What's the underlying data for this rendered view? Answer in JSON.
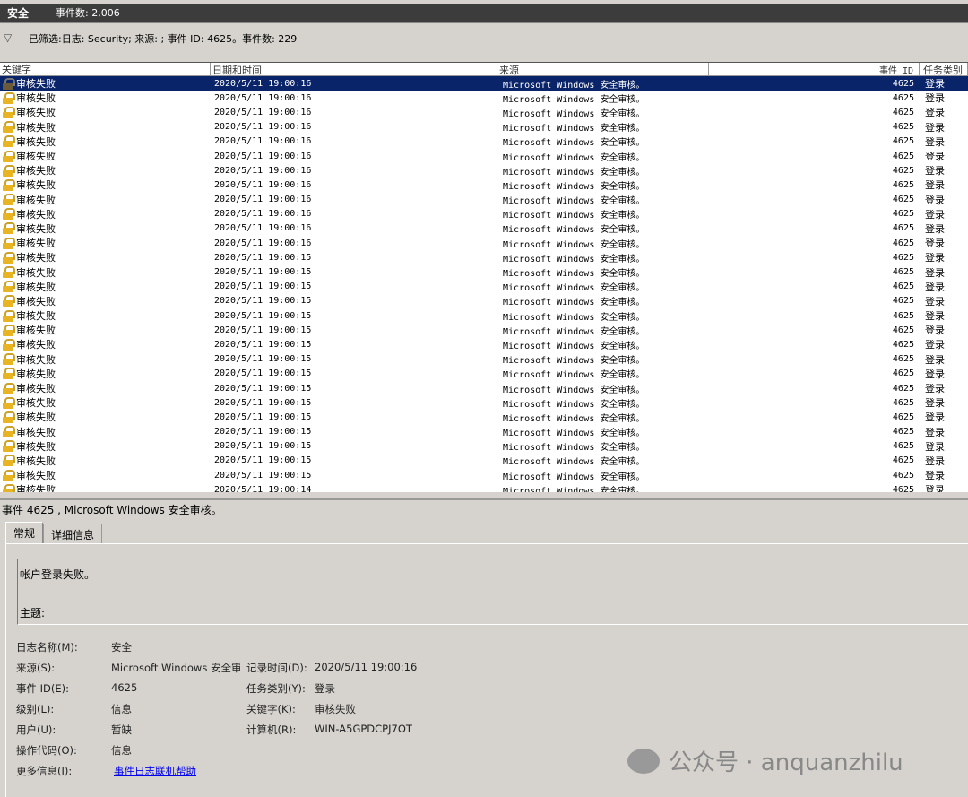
{
  "header": {
    "title": "安全",
    "event_count": "事件数: 2,006"
  },
  "filter": {
    "icon": "filter-icon",
    "text": "已筛选:日志: Security; 来源: ; 事件 ID: 4625。事件数: 229"
  },
  "columns": [
    "关键字",
    "日期和时间",
    "来源",
    "事件 ID",
    "任务类别"
  ],
  "rows": [
    [
      "审核失败",
      "2020/5/11 19:00:16",
      "Microsoft Windows 安全审核。",
      "4625",
      "登录"
    ],
    [
      "审核失败",
      "2020/5/11 19:00:16",
      "Microsoft Windows 安全审核。",
      "4625",
      "登录"
    ],
    [
      "审核失败",
      "2020/5/11 19:00:16",
      "Microsoft Windows 安全审核。",
      "4625",
      "登录"
    ],
    [
      "审核失败",
      "2020/5/11 19:00:16",
      "Microsoft Windows 安全审核。",
      "4625",
      "登录"
    ],
    [
      "审核失败",
      "2020/5/11 19:00:16",
      "Microsoft Windows 安全审核。",
      "4625",
      "登录"
    ],
    [
      "审核失败",
      "2020/5/11 19:00:16",
      "Microsoft Windows 安全审核。",
      "4625",
      "登录"
    ],
    [
      "审核失败",
      "2020/5/11 19:00:16",
      "Microsoft Windows 安全审核。",
      "4625",
      "登录"
    ],
    [
      "审核失败",
      "2020/5/11 19:00:16",
      "Microsoft Windows 安全审核。",
      "4625",
      "登录"
    ],
    [
      "审核失败",
      "2020/5/11 19:00:16",
      "Microsoft Windows 安全审核。",
      "4625",
      "登录"
    ],
    [
      "审核失败",
      "2020/5/11 19:00:16",
      "Microsoft Windows 安全审核。",
      "4625",
      "登录"
    ],
    [
      "审核失败",
      "2020/5/11 19:00:16",
      "Microsoft Windows 安全审核。",
      "4625",
      "登录"
    ],
    [
      "审核失败",
      "2020/5/11 19:00:16",
      "Microsoft Windows 安全审核。",
      "4625",
      "登录"
    ],
    [
      "审核失败",
      "2020/5/11 19:00:15",
      "Microsoft Windows 安全审核。",
      "4625",
      "登录"
    ],
    [
      "审核失败",
      "2020/5/11 19:00:15",
      "Microsoft Windows 安全审核。",
      "4625",
      "登录"
    ],
    [
      "审核失败",
      "2020/5/11 19:00:15",
      "Microsoft Windows 安全审核。",
      "4625",
      "登录"
    ],
    [
      "审核失败",
      "2020/5/11 19:00:15",
      "Microsoft Windows 安全审核。",
      "4625",
      "登录"
    ],
    [
      "审核失败",
      "2020/5/11 19:00:15",
      "Microsoft Windows 安全审核。",
      "4625",
      "登录"
    ],
    [
      "审核失败",
      "2020/5/11 19:00:15",
      "Microsoft Windows 安全审核。",
      "4625",
      "登录"
    ],
    [
      "审核失败",
      "2020/5/11 19:00:15",
      "Microsoft Windows 安全审核。",
      "4625",
      "登录"
    ],
    [
      "审核失败",
      "2020/5/11 19:00:15",
      "Microsoft Windows 安全审核。",
      "4625",
      "登录"
    ],
    [
      "审核失败",
      "2020/5/11 19:00:15",
      "Microsoft Windows 安全审核。",
      "4625",
      "登录"
    ],
    [
      "审核失败",
      "2020/5/11 19:00:15",
      "Microsoft Windows 安全审核。",
      "4625",
      "登录"
    ],
    [
      "审核失败",
      "2020/5/11 19:00:15",
      "Microsoft Windows 安全审核。",
      "4625",
      "登录"
    ],
    [
      "审核失败",
      "2020/5/11 19:00:15",
      "Microsoft Windows 安全审核。",
      "4625",
      "登录"
    ],
    [
      "审核失败",
      "2020/5/11 19:00:15",
      "Microsoft Windows 安全审核。",
      "4625",
      "登录"
    ],
    [
      "审核失败",
      "2020/5/11 19:00:15",
      "Microsoft Windows 安全审核。",
      "4625",
      "登录"
    ],
    [
      "审核失败",
      "2020/5/11 19:00:15",
      "Microsoft Windows 安全审核。",
      "4625",
      "登录"
    ],
    [
      "审核失败",
      "2020/5/11 19:00:15",
      "Microsoft Windows 安全审核。",
      "4625",
      "登录"
    ],
    [
      "审核失败",
      "2020/5/11 19:00:14",
      "Microsoft Windows 安全审核。",
      "4625",
      "登录"
    ]
  ],
  "selected_row": 0,
  "detail": {
    "title": "事件 4625 , Microsoft Windows 安全审核。",
    "tabs": [
      "常规",
      "详细信息"
    ],
    "description": "帐户登录失败。",
    "subject": "主题:",
    "log_name_label": "日志名称(M):",
    "log_name": "安全",
    "source_label": "来源(S):",
    "source": "Microsoft Windows 安全审",
    "logged_label": "记录时间(D):",
    "logged": "2020/5/11 19:00:16",
    "event_id_label": "事件 ID(E):",
    "event_id": "4625",
    "task_label": "任务类别(Y):",
    "task": "登录",
    "level_label": "级别(L):",
    "level": "信息",
    "keywords_label": "关键字(K):",
    "keywords": "审核失败",
    "user_label": "用户(U):",
    "user": "暂缺",
    "computer_label": "计算机(R):",
    "computer": "WIN-A5GPDCPJ7OT",
    "opcode_label": "操作代码(O):",
    "opcode": "信息",
    "more_label": "更多信息(I):",
    "more_link": "事件日志联机帮助"
  },
  "watermark": "公众号 · anquanzhilu"
}
